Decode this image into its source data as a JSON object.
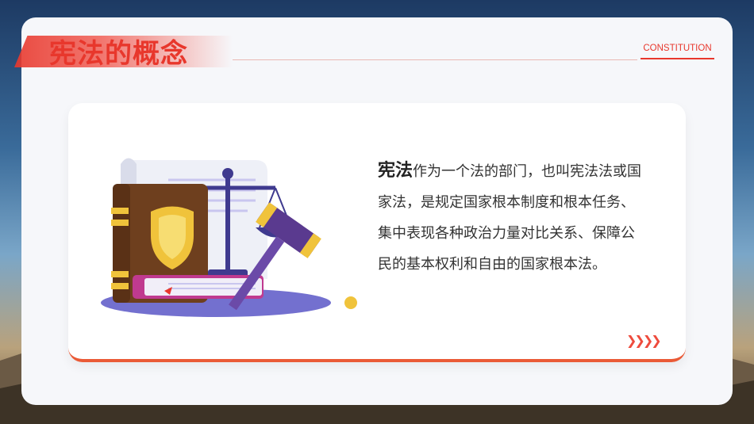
{
  "title": "宪法的概念",
  "tag": "CONSTITUTION",
  "definition": {
    "term": "宪法",
    "body": "作为一个法的部门，也叫宪法法或国家法，是规定国家根本制度和根本任务、集中表现各种政治力量对比关系、保障公民的基本权利和自由的国家根本法。"
  },
  "decor": {
    "arrows": "❯❯❯❯",
    "illustration": "law-book-gavel-scales",
    "accent_color": "#e8372c"
  }
}
